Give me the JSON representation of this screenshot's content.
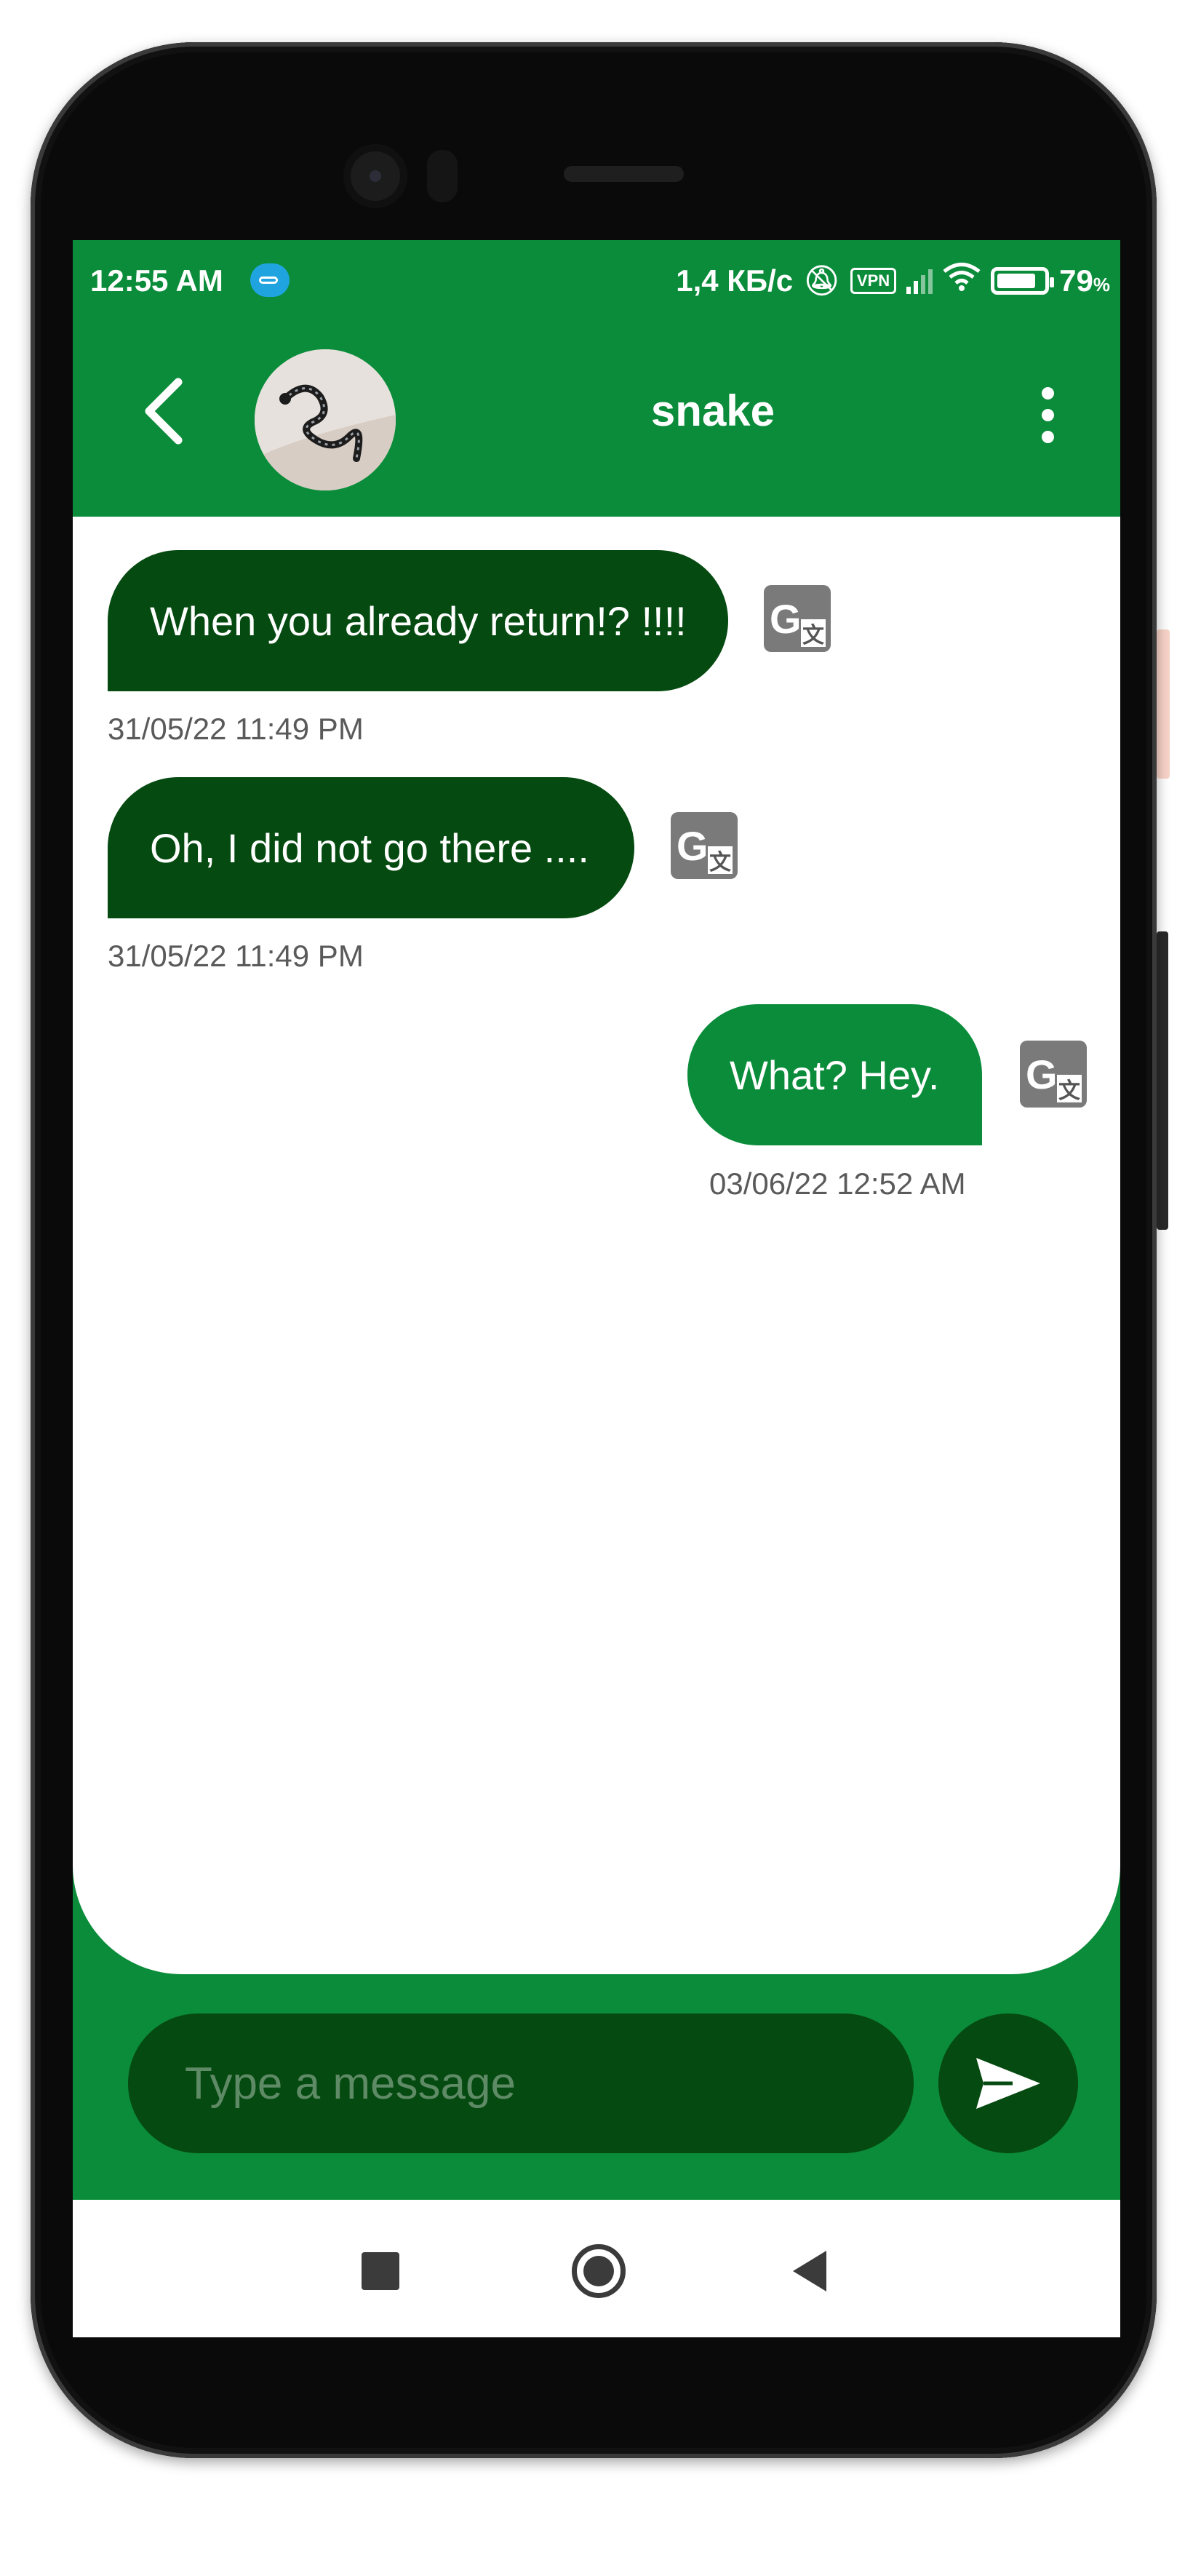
{
  "status_bar": {
    "time": "12:55 AM",
    "net_speed": "1,4 КБ/с",
    "vpn_label": "VPN",
    "battery_percent": "79",
    "battery_unit": "%"
  },
  "header": {
    "back_icon": "chevron-left-icon",
    "contact_name": "snake",
    "more_icon": "vertical-dots-icon"
  },
  "messages": [
    {
      "direction": "incoming",
      "text": "When you already return!? !!!!",
      "time": "31/05/22 11:49 PM",
      "translate_icon": "google-translate-icon"
    },
    {
      "direction": "incoming",
      "text": "Oh, I did not go there ....",
      "time": "31/05/22 11:49 PM",
      "translate_icon": "google-translate-icon"
    },
    {
      "direction": "outgoing",
      "text": "What? Hey.",
      "time": "03/06/22 12:52 AM",
      "translate_icon": "google-translate-icon"
    }
  ],
  "composer": {
    "placeholder": "Type a message",
    "send_icon": "send-icon"
  },
  "colors": {
    "brand_green": "#0b8c3a",
    "dark_green": "#054a10",
    "timestamp_gray": "#5a5a5a"
  }
}
